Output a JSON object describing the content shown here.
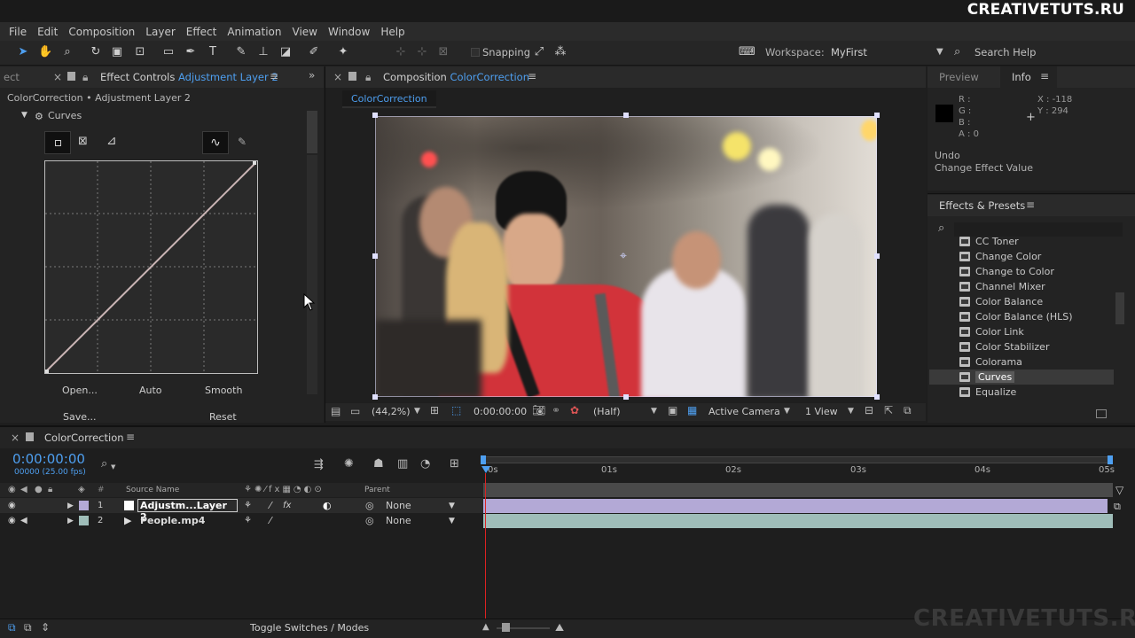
{
  "watermark": {
    "top": "CREATIVETUTS.RU",
    "bottom": "CREATIVETUTS.RU"
  },
  "menu": [
    "File",
    "Edit",
    "Composition",
    "Layer",
    "Effect",
    "Animation",
    "View",
    "Window",
    "Help"
  ],
  "toolbar": {
    "snapping_label": "Snapping",
    "workspace_label": "Workspace:",
    "workspace_value": "MyFirst",
    "search_help": "Search Help"
  },
  "effect_controls": {
    "prev_tab": "ect",
    "tab_label": "Effect Controls",
    "tab_layer": "Adjustment Layer 2",
    "breadcrumb": "ColorCorrection • Adjustment Layer 2",
    "effect_name": "Curves",
    "buttons": {
      "open": "Open...",
      "auto": "Auto",
      "smooth": "Smooth",
      "save": "Save...",
      "reset": "Reset"
    }
  },
  "composition": {
    "tab_label": "Composition",
    "tab_comp": "ColorCorrection",
    "sub_tab": "ColorCorrection",
    "zoom": "(44,2%)",
    "timecode": "0:00:00:00",
    "resolution": "(Half)",
    "camera": "Active Camera",
    "views": "1 View"
  },
  "info_panel": {
    "tab_preview": "Preview",
    "tab_info": "Info",
    "r": "R :",
    "g": "G :",
    "b": "B :",
    "a": "A : 0",
    "x": "X : -118",
    "y": "Y : 294",
    "undo": "Undo",
    "undo_detail": "Change Effect Value"
  },
  "effects_presets": {
    "title": "Effects & Presets",
    "items": [
      "CC Toner",
      "Change Color",
      "Change to Color",
      "Channel Mixer",
      "Color Balance",
      "Color Balance (HLS)",
      "Color Link",
      "Color Stabilizer",
      "Colorama",
      "Curves",
      "Equalize"
    ],
    "selected": "Curves"
  },
  "timeline": {
    "tab": "ColorCorrection",
    "timecode": "0:00:00:00",
    "fps": "00000 (25.00 fps)",
    "col_source": "Source Name",
    "col_parent": "Parent",
    "col_hash": "#",
    "layers": [
      {
        "num": "1",
        "name": "Adjustm...Layer 2",
        "parent": "None",
        "color": "#b3a9d6"
      },
      {
        "num": "2",
        "name": "People.mp4",
        "parent": "None",
        "color": "#9fbdb9"
      }
    ],
    "ticks": [
      "0s",
      "01s",
      "02s",
      "03s",
      "04s",
      "05s"
    ],
    "toggle_label": "Toggle Switches / Modes"
  }
}
